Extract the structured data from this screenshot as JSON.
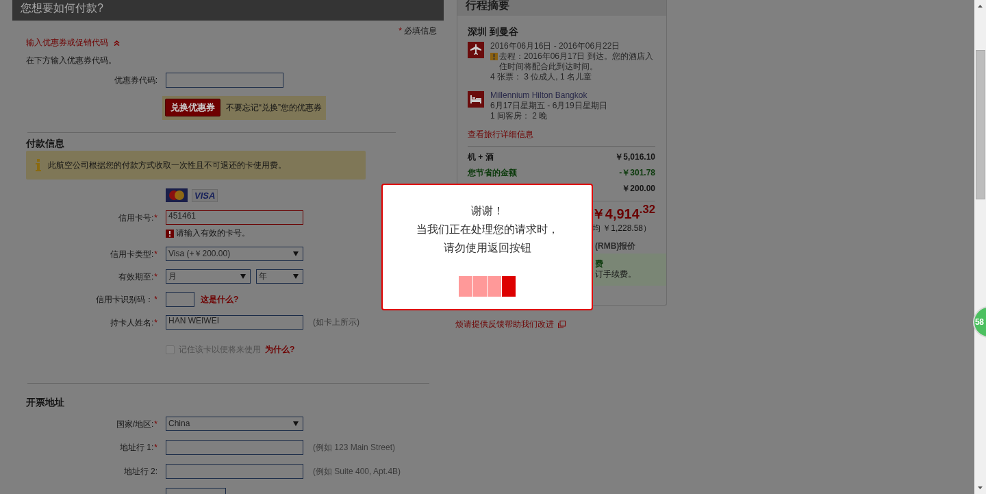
{
  "payment_header": {
    "title": "您想要如何付款?"
  },
  "required_note": {
    "mark": "*",
    "text": "必填信息"
  },
  "promo": {
    "toggle": "输入优惠券或促销代码",
    "expanded": true,
    "hint": "在下方输入优惠券代码。",
    "field_label": "优惠券代码:",
    "button": "兑换优惠券",
    "reminder": "不要忘记“兑换”您的优惠券"
  },
  "payment_info": {
    "heading": "付款信息",
    "notice": "此航空公司根据您的付款方式收取一次性且不可退还的卡使用费。",
    "visa_logo": "VISA",
    "fields": [
      {
        "kind": "input",
        "label": "信用卡号:",
        "required": true,
        "value": "451461",
        "error": "请输入有效的卡号。"
      },
      {
        "kind": "select",
        "label": "信用卡类型:",
        "required": true,
        "value": "Visa (+￥200.00)"
      },
      {
        "kind": "expiry",
        "label": "有效期至:",
        "required": true,
        "month": "月",
        "year": "年"
      },
      {
        "kind": "cvv",
        "label": "信用卡识别码：",
        "required": true,
        "link": "这是什么?"
      },
      {
        "kind": "input",
        "label": "持卡人姓名:",
        "required": true,
        "value": "HAN WEIWEI",
        "note": "(如卡上所示)"
      }
    ],
    "remember": {
      "checked": false,
      "label": "记住该卡以便将来使用",
      "link": "为什么?"
    }
  },
  "billing": {
    "heading": "开票地址",
    "fields": [
      {
        "kind": "select",
        "label": "国家/地区:",
        "required": true,
        "value": "China"
      },
      {
        "kind": "input",
        "label": "地址行 1:",
        "required": true,
        "note": "(例如 123 Main Street)"
      },
      {
        "kind": "input",
        "label": "地址行 2:",
        "required": false,
        "note": "(例如 Suite 400, Apt.4B)"
      },
      {
        "kind": "short-input"
      }
    ]
  },
  "trip_summary": {
    "title": "行程摘要",
    "route": "深圳 到曼谷",
    "items": [
      {
        "kind": "flight",
        "lines": [
          "2016年06月16日 - 2016年06月22日"
        ],
        "warning": "去程：2016年06月17日 到达。您的酒店入住时间将配合此到达时间。",
        "extra": "4 张票： 3 位成人, 1 名儿童"
      },
      {
        "kind": "hotel",
        "name": "Millennium Hilton Bangkok",
        "lines": [
          "6月17日星期五 - 6月19日星期日",
          "1 间客房： 2 晚"
        ]
      }
    ],
    "details_link": "查看旅行详细信息",
    "prices": [
      {
        "kind": "normal",
        "label": "机 + 酒",
        "amount": "￥5,016.10"
      },
      {
        "kind": "savings",
        "label": "您节省的金额",
        "amount": "-￥301.78"
      },
      {
        "kind": "normal",
        "amount": "￥200.00"
      }
    ],
    "total": "￥4,914$^{.32}$",
    "average": "均 ￥1,228.58）",
    "currency_note": "(RMB)报价",
    "fee_notice": {
      "title": "费",
      "text": "订手续费。"
    }
  },
  "feedback_link": "烦请提供反馈帮助我们改进",
  "dialog": {
    "title": "谢谢！",
    "lines": [
      "当我们正在处理您的请求时，",
      "请勿使用返回按钮"
    ],
    "segments": [
      {
        "active": false
      },
      {
        "active": false
      },
      {
        "active": false
      },
      {
        "active": true
      }
    ]
  },
  "badge": "58"
}
